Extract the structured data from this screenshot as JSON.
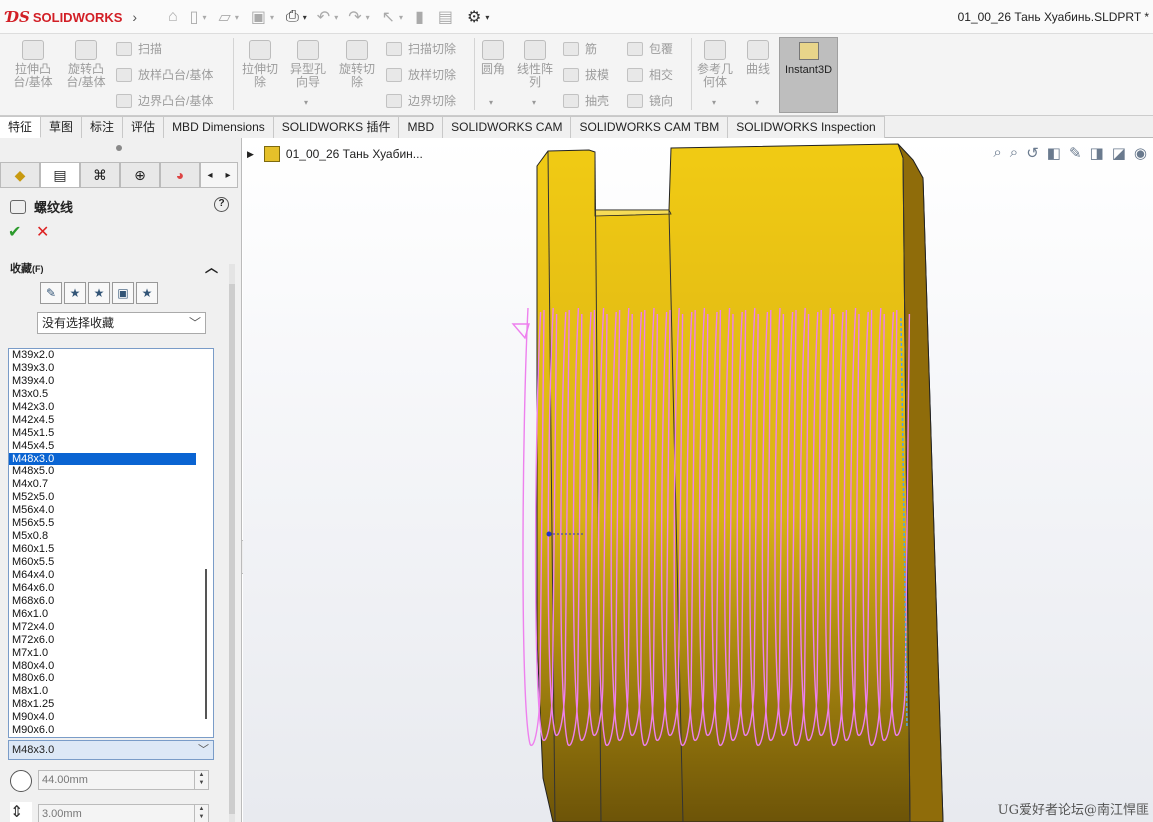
{
  "app": {
    "brand": "SOLIDWORKS",
    "doc_title": "01_00_26 Тань Хуабинь.SLDPRT *"
  },
  "ribbon": {
    "extrude_boss": "拉伸凸\n台/基体",
    "revolve_boss": "旋转凸\n台/基体",
    "sweep": "扫描",
    "loft_boss": "放样凸台/基体",
    "boundary_boss": "边界凸台/基体",
    "extrude_cut": "拉伸切\n除",
    "hole_wizard": "异型孔\n向导",
    "revolve_cut": "旋转切\n除",
    "swept_cut": "扫描切除",
    "lofted_cut": "放样切除",
    "boundary_cut": "边界切除",
    "fillet": "圆角",
    "linear_pattern": "线性阵\n列",
    "rib": "筋",
    "draft": "拔模",
    "shell": "抽壳",
    "wrap": "包覆",
    "intersect": "相交",
    "mirror": "镜向",
    "ref_geometry": "参考几\n何体",
    "curves": "曲线",
    "instant3d": "Instant3D"
  },
  "tabs": [
    "特征",
    "草图",
    "标注",
    "评估",
    "MBD Dimensions",
    "SOLIDWORKS 插件",
    "MBD",
    "SOLIDWORKS CAM",
    "SOLIDWORKS CAM TBM",
    "SOLIDWORKS Inspection"
  ],
  "panel": {
    "feature_name": "螺纹线",
    "help": "?",
    "ok": "✔",
    "cancel": "✕",
    "favorites_label": "收藏",
    "favorites_key": "(F)",
    "favorites_select": "没有选择收藏",
    "thread_list": [
      "M39x2.0",
      "M39x3.0",
      "M39x4.0",
      "M3x0.5",
      "M42x3.0",
      "M42x4.5",
      "M45x1.5",
      "M45x4.5",
      "M48x3.0",
      "M48x5.0",
      "M4x0.7",
      "M52x5.0",
      "M56x4.0",
      "M56x5.5",
      "M5x0.8",
      "M60x1.5",
      "M60x5.5",
      "M64x4.0",
      "M64x6.0",
      "M68x6.0",
      "M6x1.0",
      "M72x4.0",
      "M72x6.0",
      "M7x1.0",
      "M80x4.0",
      "M80x6.0",
      "M8x1.0",
      "M8x1.25",
      "M90x4.0",
      "M90x6.0"
    ],
    "selected_index": 8,
    "current_size": "M48x3.0",
    "diameter": "44.00mm",
    "pitch": "3.00mm"
  },
  "tree": {
    "part_name": "01_00_26 Тань Хуабин..."
  },
  "watermark": "UG爱好者论坛@南江悍匪",
  "colors": {
    "body_yellow": "#f0c81e",
    "thread_pink": "#ee80ee",
    "selection_blue": "#0a64d2"
  }
}
